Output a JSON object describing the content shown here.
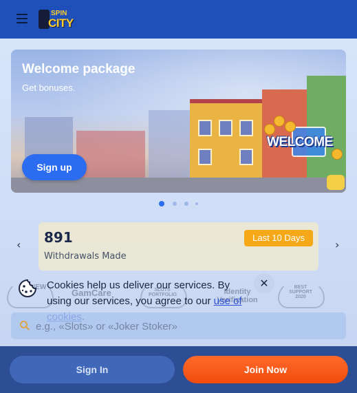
{
  "header": {
    "menu_icon": "hamburger-menu-icon",
    "logo": {
      "line1": "SPIN",
      "line2": "CITY"
    }
  },
  "banner": {
    "title": "Welcome package",
    "subtitle": "Get bonuses.",
    "cta_label": "Sign up",
    "art_text": "WELCOME"
  },
  "carousel": {
    "dot_count": 4,
    "active_index": 0
  },
  "stats": {
    "value": "891",
    "label": "Withdrawals Made",
    "period_badge": "Last 10 Days",
    "prev_icon": "chevron-left-icon",
    "next_icon": "chevron-right-icon"
  },
  "partner_logos": [
    {
      "name": "NEW",
      "caption": "VENDOR"
    },
    {
      "name": "GamCare"
    },
    {
      "name": "SLOTS PORTFOLIO"
    },
    {
      "name": "Identity Verification"
    },
    {
      "name": "BEST SUPPORT 2020"
    }
  ],
  "cookie_notice": {
    "text": "Cookies help us deliver our services. By using our services, you agree to our ",
    "link_text": "use of cookies",
    "after_link": ".",
    "icon": "cookie-icon",
    "close_icon": "close-icon"
  },
  "search": {
    "placeholder": "e.g., «Slots» or «Joker Stoker»",
    "value": "",
    "icon": "search-icon"
  },
  "footer": {
    "sign_in_label": "Sign In",
    "join_label": "Join Now"
  },
  "colors": {
    "header_bg": "#1f4fb8",
    "brand_yellow": "#ffce2e",
    "primary_blue": "#2b6cf0",
    "badge_orange": "#f5a818",
    "join_orange": "#f24c0c",
    "footer_bg": "#2d4d94"
  }
}
